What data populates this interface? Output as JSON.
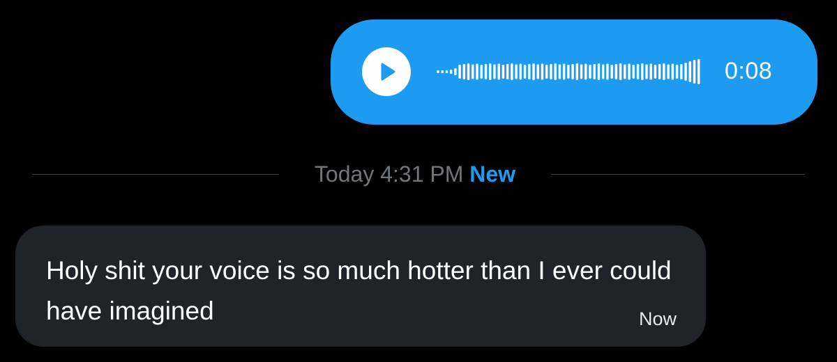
{
  "voice_message": {
    "duration": "0:08",
    "play_icon": "play-icon",
    "waveform_icon": "waveform-icon",
    "bubble_color": "#1d9bf0"
  },
  "divider": {
    "timestamp": "Today 4:31 PM",
    "new_label": "New",
    "new_color": "#1d9bf0"
  },
  "received_message": {
    "text": "Holy shit your voice is so much hotter than I ever could have imagined",
    "time": "Now",
    "bubble_color": "#202327"
  }
}
